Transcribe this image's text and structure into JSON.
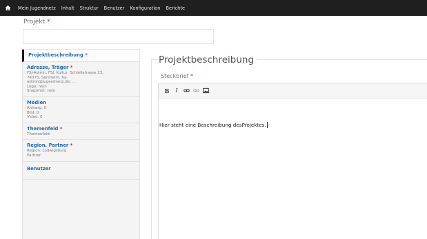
{
  "topbar": {
    "home_icon": "home-icon",
    "items": [
      "Mein Jugendnetz",
      "Inhalt",
      "Struktur",
      "Benutzer",
      "Konfiguration",
      "Berichte"
    ]
  },
  "form": {
    "projekt_label": "Projekt",
    "required_mark": "*",
    "projekt_value": ""
  },
  "tabs": [
    {
      "title": "Projektbeschreibung",
      "required": "*",
      "summary": []
    },
    {
      "title": "Adresse, Träger",
      "required": "*",
      "summary": [
        "FSJ-Admin, FSJ, Kultur, Schloßstrasse 23,",
        "74370, Sersheim, fsj-",
        "admin@jugendnetz.de, ...",
        "Logo: nein",
        "Snapshot: nein"
      ]
    },
    {
      "title": "Medien",
      "required": "",
      "summary": [
        "Anhang: 0",
        "Bild: 0",
        "Video: 0"
      ]
    },
    {
      "title": "Themenfeld",
      "required": "*",
      "summary": [
        "Themenfeld:"
      ]
    },
    {
      "title": "Region, Partner",
      "required": "*",
      "summary": [
        "Region: Ludwigsburg",
        "Partner:"
      ]
    },
    {
      "title": "Benutzer",
      "required": "",
      "summary": []
    }
  ],
  "section": {
    "legend": "Projektbeschreibung",
    "steckbrief_label": "Steckbrief",
    "toolbar": [
      "bold",
      "italic",
      "link-icon",
      "unlink-icon",
      "image-icon"
    ],
    "body_text": "Hier steht eine Beschreibung desProjektes."
  },
  "colors": {
    "topbar": "#1f1f1f",
    "link": "#1f6ab0",
    "required": "#e0162b"
  }
}
